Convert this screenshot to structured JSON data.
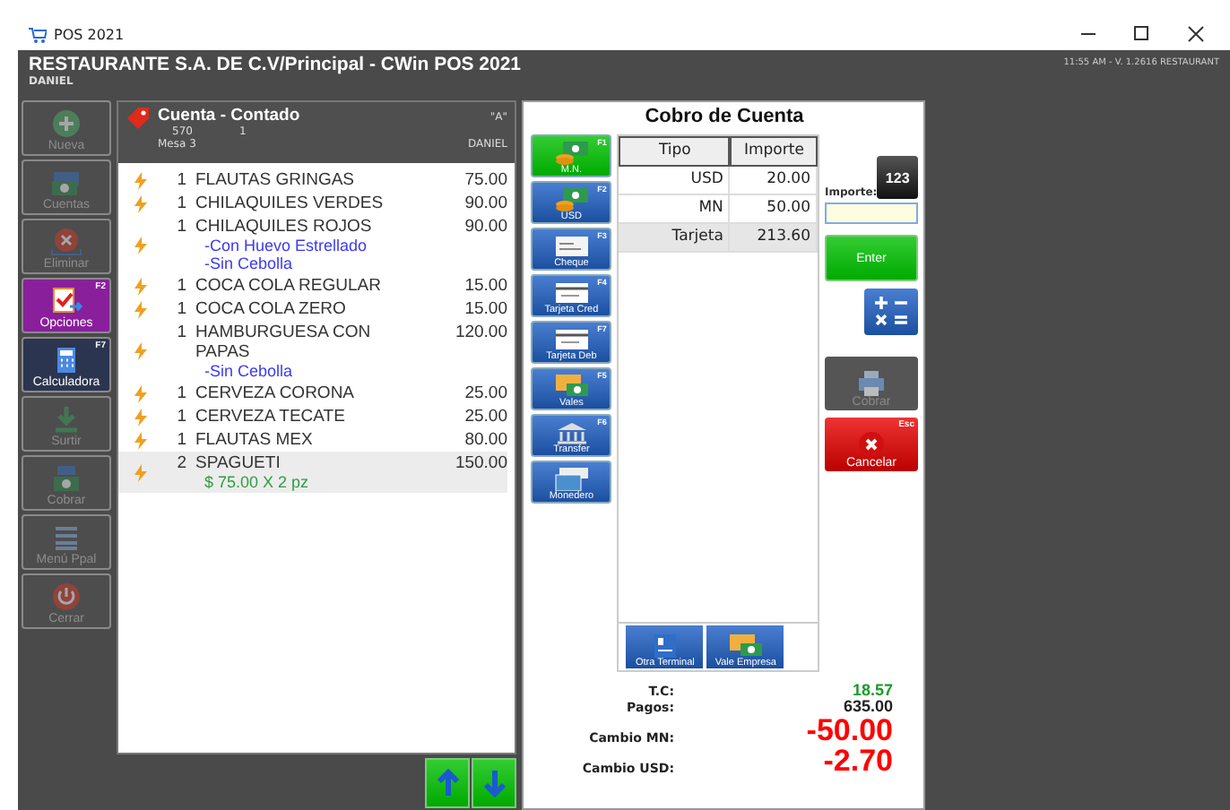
{
  "window": {
    "title": "POS 2021"
  },
  "header": {
    "title": "RESTAURANTE S.A. DE C.V/Principal - CWin POS 2021",
    "user": "DANIEL",
    "status": "11:55 AM - V. 1.2616 RESTAURANT"
  },
  "sidebar": [
    {
      "label": "Nueva",
      "kind": "plus",
      "disabled": true,
      "color": "#4d4d4d"
    },
    {
      "label": "Cuentas",
      "kind": "money",
      "disabled": true,
      "color": "#4d4d4d"
    },
    {
      "label": "Eliminar",
      "kind": "delete",
      "disabled": true,
      "color": "#4d4d4d"
    },
    {
      "label": "Opciones",
      "kind": "options",
      "disabled": false,
      "color": "#8a1f9c",
      "hotkey": "F2"
    },
    {
      "label": "Calculadora",
      "kind": "calc",
      "disabled": false,
      "color": "#2c3550",
      "hotkey": "F7"
    },
    {
      "label": "Surtir",
      "kind": "down",
      "disabled": true,
      "color": "#4d4d4d"
    },
    {
      "label": "Cobrar",
      "kind": "register",
      "disabled": true,
      "color": "#4d4d4d"
    },
    {
      "label": "Menú Ppal",
      "kind": "menu",
      "disabled": true,
      "color": "#4d4d4d"
    },
    {
      "label": "Cerrar",
      "kind": "power",
      "disabled": true,
      "color": "#4d4d4d"
    }
  ],
  "ticket": {
    "title": "Cuenta - Contado",
    "tag": "\"A\"",
    "number": "570",
    "guests": "1",
    "table": "Mesa 3",
    "waiter": "DANIEL",
    "items": [
      {
        "qty": "1",
        "name": "FLAUTAS GRINGAS",
        "price": "75.00",
        "selected": false
      },
      {
        "qty": "1",
        "name": "CHILAQUILES VERDES",
        "price": "90.00",
        "selected": false
      },
      {
        "qty": "1",
        "name": "CHILAQUILES ROJOS",
        "price": "90.00",
        "modifiers": [
          "-Con Huevo Estrellado",
          "-Sin Cebolla"
        ],
        "selected": false
      },
      {
        "qty": "1",
        "name": "COCA COLA REGULAR",
        "price": "15.00",
        "selected": false
      },
      {
        "qty": "1",
        "name": "COCA COLA ZERO",
        "price": "15.00",
        "selected": false
      },
      {
        "qty": "1",
        "name": "HAMBURGUESA CON PAPAS",
        "price": "120.00",
        "modifiers": [
          "-Sin Cebolla"
        ],
        "selected": false
      },
      {
        "qty": "1",
        "name": "CERVEZA CORONA",
        "price": "25.00",
        "selected": false
      },
      {
        "qty": "1",
        "name": "CERVEZA TECATE",
        "price": "25.00",
        "selected": false
      },
      {
        "qty": "1",
        "name": "FLAUTAS MEX",
        "price": "80.00",
        "selected": false
      },
      {
        "qty": "2",
        "name": "SPAGUETI",
        "price": "150.00",
        "note": "$ 75.00 X 2 pz",
        "selected": true
      }
    ]
  },
  "payment": {
    "title": "Cobro de Cuenta",
    "methods": [
      {
        "label": "M.N.",
        "hotkey": "F1",
        "kind": "cash",
        "selected": true
      },
      {
        "label": "USD",
        "hotkey": "F2",
        "kind": "cash",
        "selected": false
      },
      {
        "label": "Cheque",
        "hotkey": "F3",
        "kind": "check",
        "selected": false
      },
      {
        "label": "Tarjeta Cred",
        "hotkey": "F4",
        "kind": "card",
        "selected": false
      },
      {
        "label": "Tarjeta Deb",
        "hotkey": "F7",
        "kind": "card",
        "selected": false
      },
      {
        "label": "Vales",
        "hotkey": "F5",
        "kind": "voucher",
        "selected": false
      },
      {
        "label": "Transfer",
        "hotkey": "F6",
        "kind": "bank",
        "selected": false
      },
      {
        "label": "Monedero",
        "kind": "wallet",
        "selected": false
      }
    ],
    "columns": [
      "Tipo",
      "Importe"
    ],
    "rows": [
      {
        "type": "USD",
        "amount": "20.00",
        "selected": false
      },
      {
        "type": "MN",
        "amount": "50.00",
        "selected": false
      },
      {
        "type": "Tarjeta",
        "amount": "213.60",
        "selected": true
      }
    ],
    "extra_methods": [
      {
        "label": "Otra Terminal",
        "kind": "terminal"
      },
      {
        "label": "Vale Empresa",
        "kind": "voucher"
      }
    ],
    "keypad_label": "123",
    "amount_label": "Importe:",
    "enter": "Enter",
    "charge": {
      "label": "Cobrar",
      "disabled": true
    },
    "cancel": {
      "label": "Cancelar",
      "hotkey": "Esc"
    },
    "totals": [
      {
        "label": "T.C:",
        "value": "18.57",
        "kind": "rate"
      },
      {
        "label": "Pagos:",
        "value": "635.00",
        "kind": "normal"
      },
      {
        "label": "Cambio MN:",
        "value": "-50.00",
        "kind": "big"
      },
      {
        "label": "Cambio USD:",
        "value": "-2.70",
        "kind": "big"
      }
    ]
  }
}
